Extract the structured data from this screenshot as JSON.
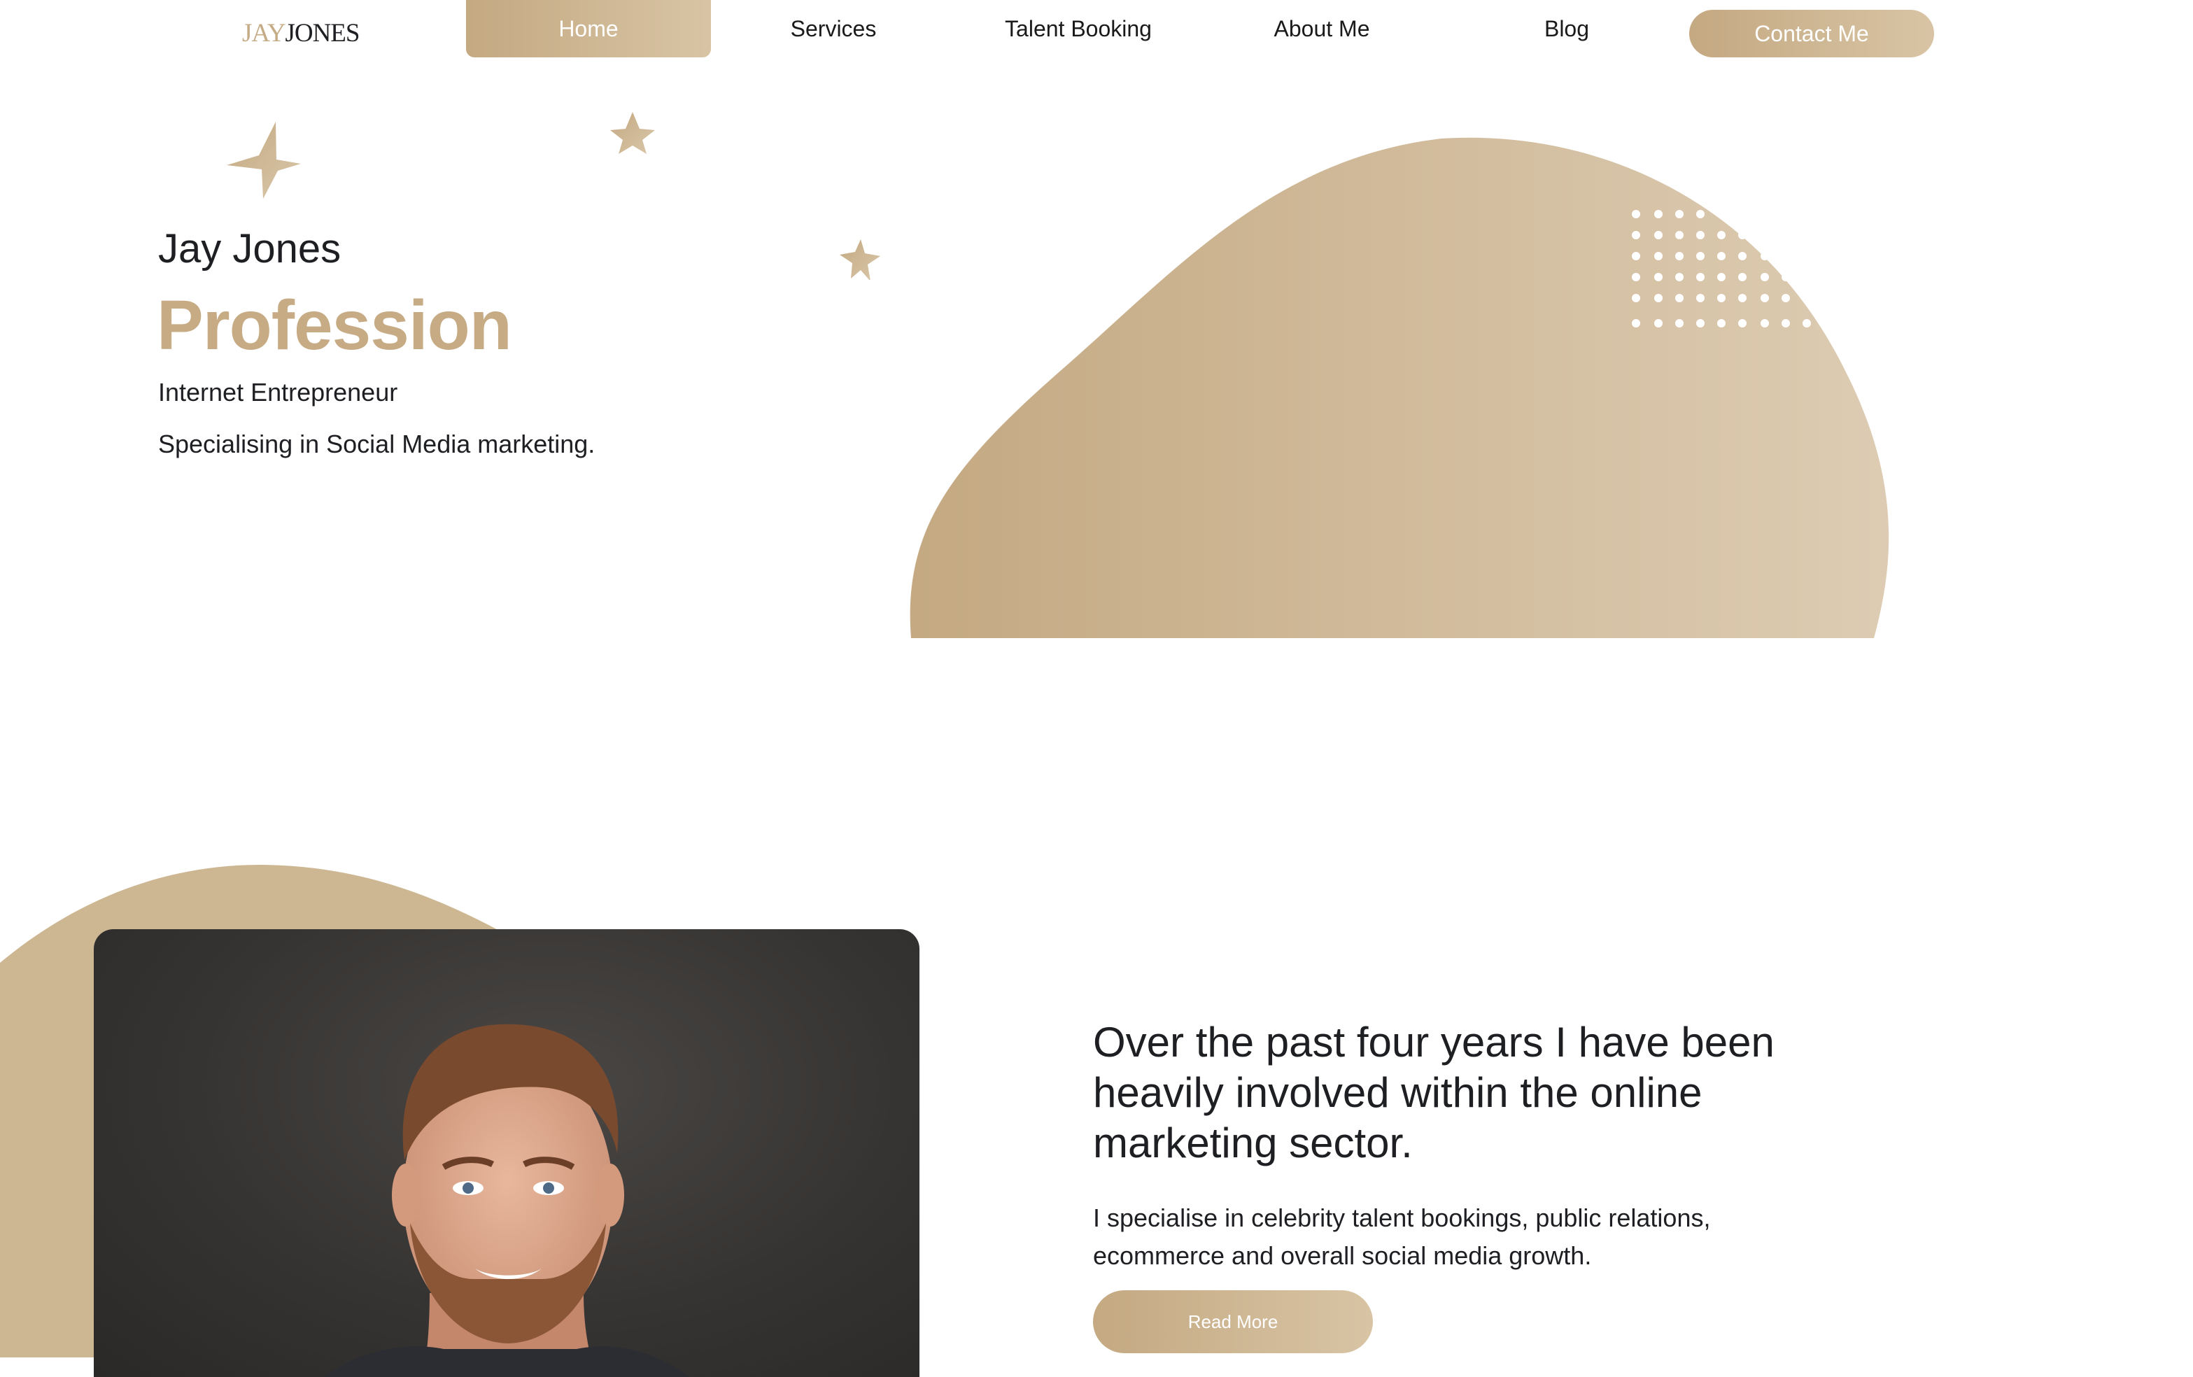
{
  "brand": {
    "logo_first": "JAY",
    "logo_second": "JONES"
  },
  "nav": {
    "items": [
      {
        "label": "Home"
      },
      {
        "label": "Services"
      },
      {
        "label": "Talent Booking"
      },
      {
        "label": "About Me"
      },
      {
        "label": "Blog"
      }
    ],
    "active": "Home",
    "contact_label": "Contact Me"
  },
  "hero": {
    "name": "Jay Jones",
    "title": "Profession",
    "line1": "Internet Entrepreneur",
    "line2": "Specialising in Social Media marketing."
  },
  "about": {
    "heading": "Over the past four years I have been heavily involved within the online marketing sector.",
    "body": "I specialise in celebrity talent bookings, public relations, ecommerce and overall social media growth.",
    "button_label": "Read More"
  },
  "colors": {
    "accent": "#c5ab85",
    "accent_light": "#ddccb2",
    "text": "#1e1f22",
    "background": "#ffffff"
  }
}
